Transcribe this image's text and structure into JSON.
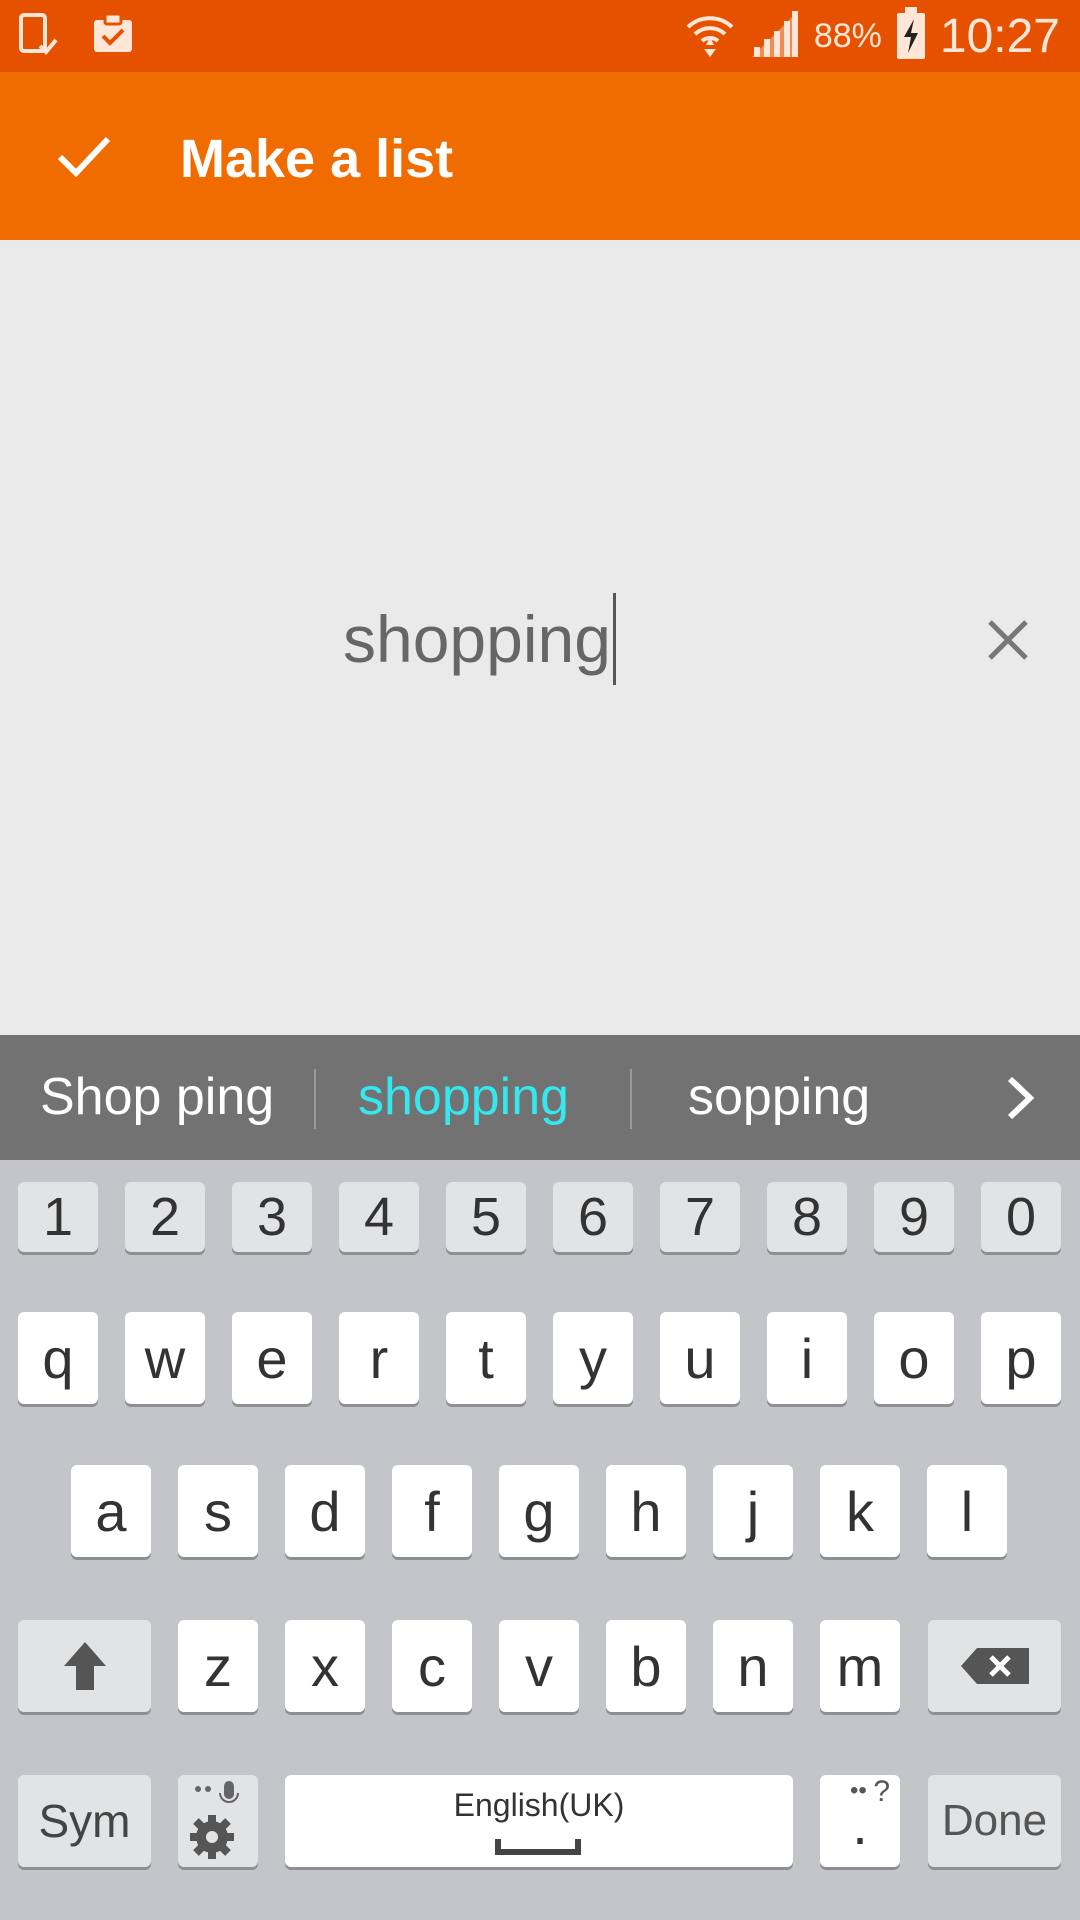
{
  "status_bar": {
    "battery_percent": "88%",
    "time": "10:27",
    "icons": [
      "device-sync-icon",
      "clipboard-check-icon",
      "wifi-icon",
      "signal-icon",
      "battery-charging-icon"
    ]
  },
  "app_bar": {
    "title": "Make a list",
    "confirm_icon": "check-icon"
  },
  "editor": {
    "value": "shopping",
    "clear_icon": "close-icon"
  },
  "suggestions": {
    "items": [
      "Shop ping",
      "shopping",
      "sopping"
    ],
    "selected": "shopping",
    "more_icon": "chevron-right-icon",
    "highlight_color": "#35e7ef"
  },
  "keyboard": {
    "numbers": [
      "1",
      "2",
      "3",
      "4",
      "5",
      "6",
      "7",
      "8",
      "9",
      "0"
    ],
    "row1": [
      "q",
      "w",
      "e",
      "r",
      "t",
      "y",
      "u",
      "i",
      "o",
      "p"
    ],
    "row2": [
      "a",
      "s",
      "d",
      "f",
      "g",
      "h",
      "j",
      "k",
      "l"
    ],
    "row3": [
      "z",
      "x",
      "c",
      "v",
      "b",
      "n",
      "m"
    ],
    "sym_label": "Sym",
    "space_label": "English(UK)",
    "period_label": ".",
    "period_hint": "?",
    "done_label": "Done"
  },
  "colors": {
    "status_bar": "#e65100",
    "app_bar": "#f06c00"
  }
}
